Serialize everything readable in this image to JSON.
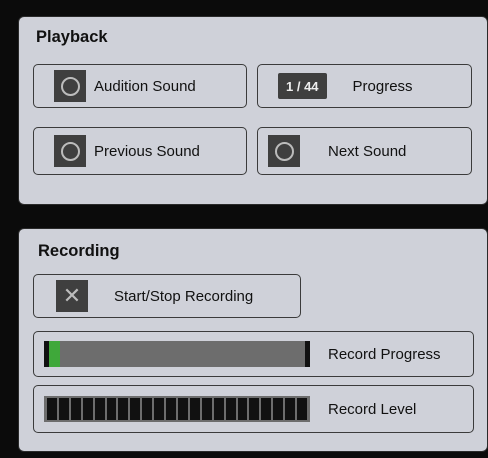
{
  "playback": {
    "title": "Playback",
    "audition_label": "Audition Sound",
    "progress_counter": "1 / 44",
    "progress_label": "Progress",
    "previous_label": "Previous Sound",
    "next_label": "Next Sound"
  },
  "recording": {
    "title": "Recording",
    "start_stop_label": "Start/Stop Recording",
    "record_progress_label": "Record Progress",
    "record_progress_value": 0.04,
    "record_level_label": "Record Level",
    "record_level_segments": 22,
    "record_level_value": 0
  },
  "colors": {
    "panel_bg": "#cfd1d9",
    "control_bg": "#3f3f3f",
    "progress_fill": "#3fa83a",
    "meter_track": "#6d6d6d"
  },
  "icons": {
    "toggle": "circle-icon",
    "record_toggle": "x-icon"
  }
}
